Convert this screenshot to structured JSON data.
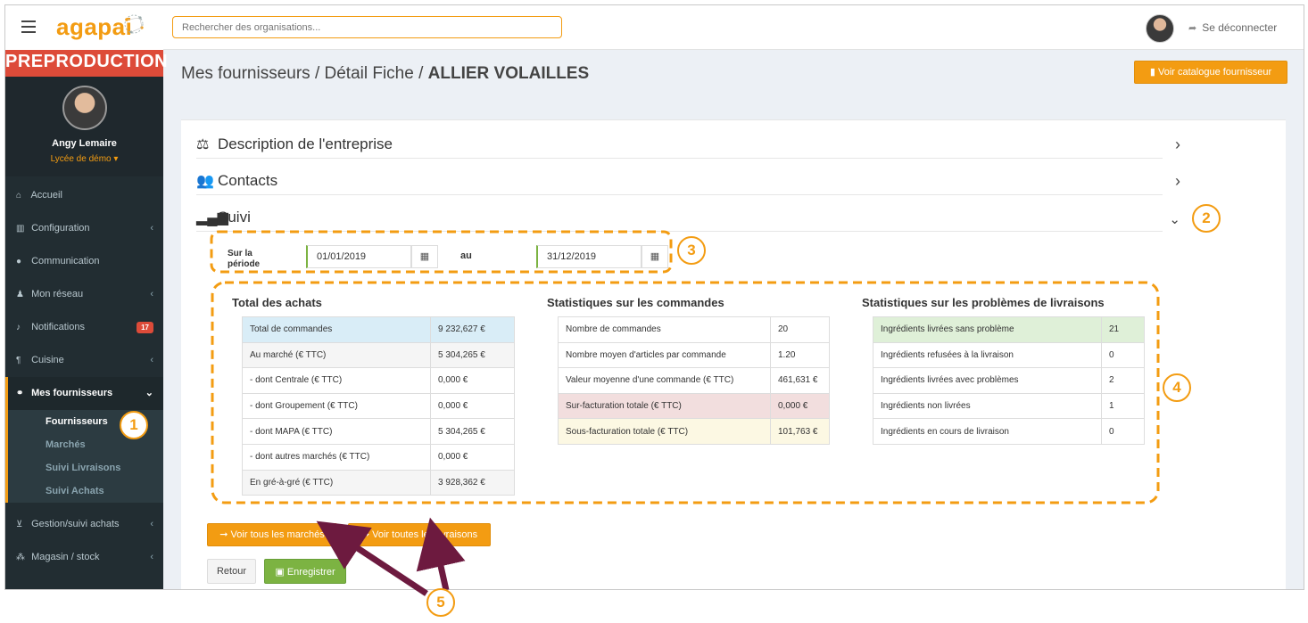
{
  "topbar": {
    "logo": "agapai",
    "search_placeholder": "Rechercher des organisations...",
    "logout_label": "Se déconnecter"
  },
  "sidebar": {
    "env_banner": "PREPRODUCTION",
    "user_name": "Angy Lemaire",
    "user_org": "Lycée de démo ▾",
    "items": [
      {
        "label": "Accueil",
        "icon": "home-icon"
      },
      {
        "label": "Configuration",
        "icon": "bank-icon"
      },
      {
        "label": "Communication",
        "icon": "comments-icon"
      },
      {
        "label": "Mon réseau",
        "icon": "users-icon"
      },
      {
        "label": "Notifications",
        "icon": "bell-icon",
        "badge": "17"
      },
      {
        "label": "Cuisine",
        "icon": "cutlery-icon"
      },
      {
        "label": "Mes fournisseurs",
        "icon": "handshake-icon"
      },
      {
        "label": "Gestion/suivi achats",
        "icon": "cart-icon"
      },
      {
        "label": "Magasin / stock",
        "icon": "cubes-icon"
      }
    ],
    "subitems": [
      "Fournisseurs",
      "Marchés",
      "Suivi Livraisons",
      "Suivi Achats"
    ]
  },
  "header": {
    "breadcrumb": "Mes fournisseurs / Détail Fiche / ",
    "title": "ALLIER VOLAILLES",
    "catalog_button": "Voir catalogue fournisseur"
  },
  "sections": {
    "description": "Description de l'entreprise",
    "contacts": "Contacts",
    "suivi": "Suivi"
  },
  "period": {
    "label_line1": "Sur la",
    "label_line2": "période",
    "from": "01/01/2019",
    "to_label": "au",
    "to": "31/12/2019"
  },
  "achats": {
    "title": "Total des achats",
    "rows": [
      {
        "label": "Total de commandes",
        "value": "9 232,627 €"
      },
      {
        "label": "Au marché (€ TTC)",
        "value": "5 304,265 €"
      },
      {
        "label": "- dont Centrale (€ TTC)",
        "value": "0,000 €"
      },
      {
        "label": "- dont Groupement (€ TTC)",
        "value": "0,000 €"
      },
      {
        "label": "- dont MAPA (€ TTC)",
        "value": "5 304,265 €"
      },
      {
        "label": "- dont autres marchés (€ TTC)",
        "value": "0,000 €"
      },
      {
        "label": "En gré-à-gré (€ TTC)",
        "value": "3 928,362 €"
      }
    ]
  },
  "commandes": {
    "title": "Statistiques sur les commandes",
    "rows": [
      {
        "label": "Nombre de commandes",
        "value": "20"
      },
      {
        "label": "Nombre moyen d'articles par commande",
        "value": "1.20"
      },
      {
        "label": "Valeur moyenne d'une commande (€ TTC)",
        "value": "461,631 €"
      },
      {
        "label": "Sur-facturation totale (€ TTC)",
        "value": "0,000 €"
      },
      {
        "label": "Sous-facturation totale (€ TTC)",
        "value": "101,763 €"
      }
    ]
  },
  "livraisons": {
    "title": "Statistiques sur les problèmes de livraisons",
    "rows": [
      {
        "label": "Ingrédients livrées sans problème",
        "value": "21"
      },
      {
        "label": "Ingrédients refusées à la livraison",
        "value": "0"
      },
      {
        "label": "Ingrédients livrées avec problèmes",
        "value": "2"
      },
      {
        "label": "Ingrédients non livrées",
        "value": "1"
      },
      {
        "label": "Ingrédients en cours de livraison",
        "value": "0"
      }
    ]
  },
  "actions": {
    "marches": "➞ Voir tous les marchés",
    "livraisons": "➞ Voir toutes les livraisons",
    "retour": "Retour",
    "save": "Enregistrer"
  },
  "annotations": [
    "1",
    "2",
    "3",
    "4",
    "5"
  ],
  "colors": {
    "accent": "#f39c12",
    "sidebar": "#222d32",
    "banner": "#dd4b39",
    "arrow": "#6d1a3f",
    "save": "#7cb342"
  }
}
